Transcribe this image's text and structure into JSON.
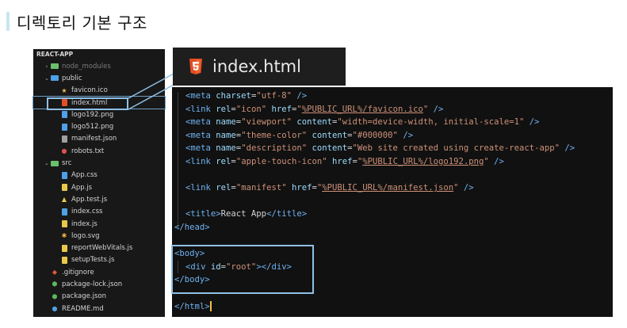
{
  "slide": {
    "title": "디렉토리 기본 구조"
  },
  "explorer": {
    "root": "REACT-APP",
    "items": [
      {
        "label": "node_modules",
        "depth": 1,
        "chev": ">",
        "icon": "folder-green",
        "dim": true
      },
      {
        "label": "public",
        "depth": 1,
        "chev": "v",
        "icon": "folder-blue"
      },
      {
        "label": "favicon.ico",
        "depth": 2,
        "icon": "star"
      },
      {
        "label": "index.html",
        "depth": 2,
        "icon": "html5",
        "selected": true
      },
      {
        "label": "logo192.png",
        "depth": 2,
        "icon": "image"
      },
      {
        "label": "logo512.png",
        "depth": 2,
        "icon": "image"
      },
      {
        "label": "manifest.json",
        "depth": 2,
        "icon": "json"
      },
      {
        "label": "robots.txt",
        "depth": 2,
        "icon": "robot"
      },
      {
        "label": "src",
        "depth": 1,
        "chev": "v",
        "icon": "folder-green"
      },
      {
        "label": "App.css",
        "depth": 2,
        "icon": "css"
      },
      {
        "label": "App.js",
        "depth": 2,
        "icon": "js"
      },
      {
        "label": "App.test.js",
        "depth": 2,
        "icon": "test"
      },
      {
        "label": "index.css",
        "depth": 2,
        "icon": "css"
      },
      {
        "label": "index.js",
        "depth": 2,
        "icon": "js"
      },
      {
        "label": "logo.svg",
        "depth": 2,
        "icon": "svg"
      },
      {
        "label": "reportWebVitals.js",
        "depth": 2,
        "icon": "js"
      },
      {
        "label": "setupTests.js",
        "depth": 2,
        "icon": "js"
      },
      {
        "label": ".gitignore",
        "depth": 1,
        "icon": "git"
      },
      {
        "label": "package-lock.json",
        "depth": 1,
        "icon": "npm"
      },
      {
        "label": "package.json",
        "depth": 1,
        "icon": "npm"
      },
      {
        "label": "README.md",
        "depth": 1,
        "icon": "info"
      }
    ]
  },
  "tab": {
    "filename": "index.html"
  },
  "editor": {
    "lines": [
      {
        "indent": 1,
        "parts": [
          [
            "tag",
            "<meta "
          ],
          [
            "attr",
            "charset"
          ],
          [
            "txt",
            "="
          ],
          [
            "val",
            "\"utf-8\""
          ],
          [
            "tag",
            " />"
          ]
        ]
      },
      {
        "indent": 1,
        "parts": [
          [
            "tag",
            "<link "
          ],
          [
            "attr",
            "rel"
          ],
          [
            "txt",
            "="
          ],
          [
            "val",
            "\"icon\""
          ],
          [
            "attr",
            " href"
          ],
          [
            "txt",
            "="
          ],
          [
            "val",
            "\""
          ],
          [
            "valu",
            "%PUBLIC_URL%/favicon.ico"
          ],
          [
            "val",
            "\""
          ],
          [
            "tag",
            " />"
          ]
        ]
      },
      {
        "indent": 1,
        "parts": [
          [
            "tag",
            "<meta "
          ],
          [
            "attr",
            "name"
          ],
          [
            "txt",
            "="
          ],
          [
            "val",
            "\"viewport\""
          ],
          [
            "attr",
            " content"
          ],
          [
            "txt",
            "="
          ],
          [
            "val",
            "\"width=device-width, initial-scale=1\""
          ],
          [
            "tag",
            " />"
          ]
        ]
      },
      {
        "indent": 1,
        "parts": [
          [
            "tag",
            "<meta "
          ],
          [
            "attr",
            "name"
          ],
          [
            "txt",
            "="
          ],
          [
            "val",
            "\"theme-color\""
          ],
          [
            "attr",
            " content"
          ],
          [
            "txt",
            "="
          ],
          [
            "val",
            "\"#000000\""
          ],
          [
            "tag",
            " />"
          ]
        ]
      },
      {
        "indent": 1,
        "parts": [
          [
            "tag",
            "<meta "
          ],
          [
            "attr",
            "name"
          ],
          [
            "txt",
            "="
          ],
          [
            "val",
            "\"description\""
          ],
          [
            "attr",
            " content"
          ],
          [
            "txt",
            "="
          ],
          [
            "val",
            "\"Web site created using create-react-app\""
          ],
          [
            "tag",
            " />"
          ]
        ]
      },
      {
        "indent": 1,
        "parts": [
          [
            "tag",
            "<link "
          ],
          [
            "attr",
            "rel"
          ],
          [
            "txt",
            "="
          ],
          [
            "val",
            "\"apple-touch-icon\""
          ],
          [
            "attr",
            " href"
          ],
          [
            "txt",
            "="
          ],
          [
            "val",
            "\""
          ],
          [
            "valu",
            "%PUBLIC_URL%/logo192.png"
          ],
          [
            "val",
            "\""
          ],
          [
            "tag",
            " />"
          ]
        ]
      },
      {
        "indent": 1,
        "parts": []
      },
      {
        "indent": 1,
        "parts": [
          [
            "tag",
            "<link "
          ],
          [
            "attr",
            "rel"
          ],
          [
            "txt",
            "="
          ],
          [
            "val",
            "\"manifest\""
          ],
          [
            "attr",
            " href"
          ],
          [
            "txt",
            "="
          ],
          [
            "val",
            "\""
          ],
          [
            "valu",
            "%PUBLIC_URL%/manifest.json"
          ],
          [
            "val",
            "\""
          ],
          [
            "tag",
            " />"
          ]
        ]
      },
      {
        "indent": 1,
        "parts": []
      },
      {
        "indent": 1,
        "parts": [
          [
            "tag",
            "<title>"
          ],
          [
            "txt",
            "React App"
          ],
          [
            "tag",
            "</title>"
          ]
        ]
      },
      {
        "indent": 0,
        "parts": [
          [
            "tag",
            "</head>"
          ]
        ]
      },
      {
        "indent": 0,
        "parts": []
      },
      {
        "indent": 0,
        "parts": [
          [
            "tag",
            "<body>"
          ]
        ]
      },
      {
        "indent": 1,
        "parts": [
          [
            "tag",
            "<div "
          ],
          [
            "attr",
            "id"
          ],
          [
            "txt",
            "="
          ],
          [
            "val",
            "\"root\""
          ],
          [
            "tag",
            "></div>"
          ]
        ]
      },
      {
        "indent": 0,
        "parts": [
          [
            "tag",
            "</body>"
          ]
        ]
      },
      {
        "indent": 0,
        "parts": []
      },
      {
        "indent": 0,
        "parts": [
          [
            "tag",
            "</html>"
          ]
        ],
        "cursor": true
      }
    ]
  }
}
